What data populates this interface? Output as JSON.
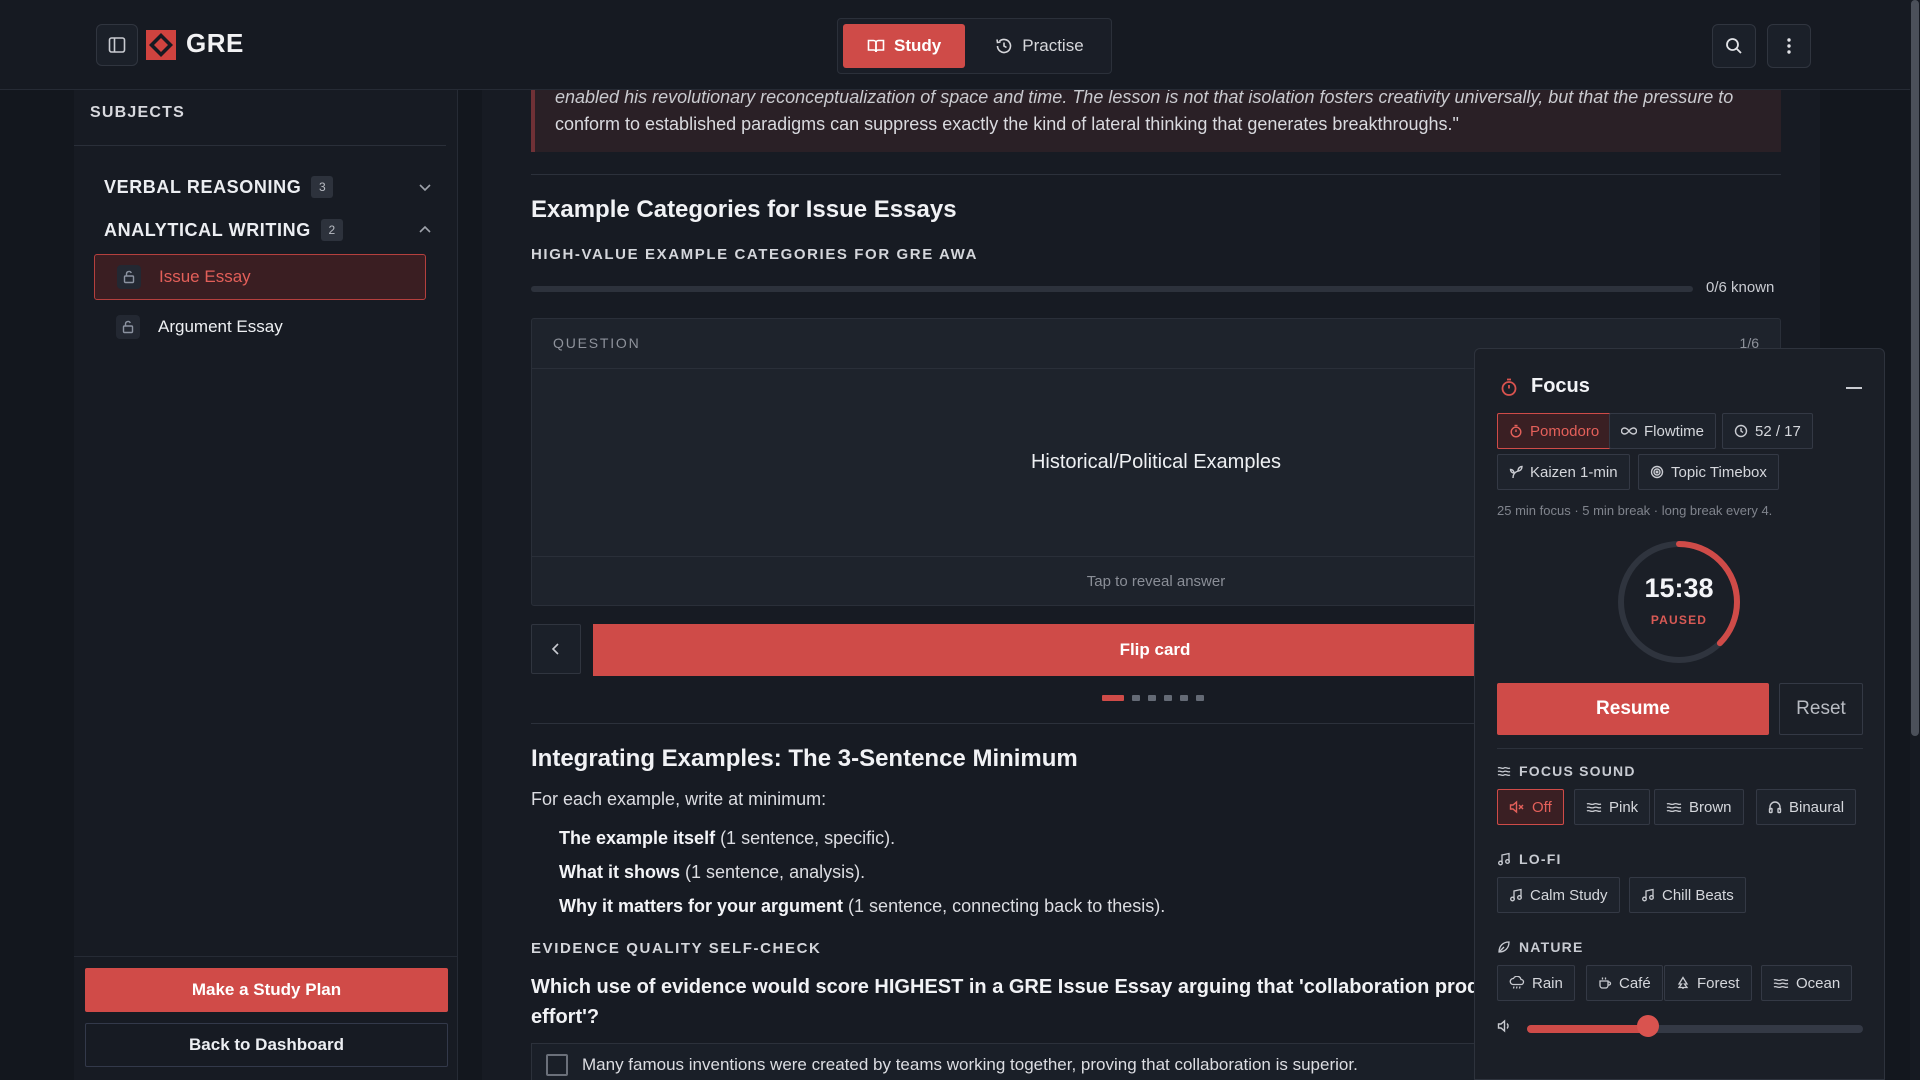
{
  "header": {
    "app_title": "GRE",
    "modes": [
      {
        "label": "Study",
        "icon": "book-open-icon",
        "active": true
      },
      {
        "label": "Practise",
        "icon": "history-icon",
        "active": false
      }
    ]
  },
  "sidebar": {
    "heading": "SUBJECTS",
    "groups": [
      {
        "label": "VERBAL REASONING",
        "count": "3",
        "expanded": false
      },
      {
        "label": "ANALYTICAL WRITING",
        "count": "2",
        "expanded": true
      }
    ],
    "items": [
      {
        "label": "Issue Essay",
        "active": true
      },
      {
        "label": "Argument Essay",
        "active": false
      }
    ],
    "footer": {
      "primary_label": "Make a Study Plan",
      "secondary_label": "Back to Dashboard"
    }
  },
  "main": {
    "quote_line1": "enabled his revolutionary reconceptualization of space and time. The lesson is not that isolation fosters creativity universally, but that the pressure to",
    "quote_line2": "conform to established paradigms can suppress exactly the kind of lateral thinking that generates breakthroughs.\"",
    "section1_title": "Example Categories for Issue Essays",
    "deck_title": "HIGH-VALUE EXAMPLE CATEGORIES FOR GRE AWA",
    "progress_label": "0/6 known",
    "progress_fraction": 0,
    "card": {
      "kind": "QUESTION",
      "position": "1/6",
      "text": "Historical/Political Examples",
      "hint": "Tap to reveal answer"
    },
    "flip_label": "Flip card",
    "dots_total": 6,
    "dots_active_index": 0,
    "section2_title": "Integrating Examples: The 3-Sentence Minimum",
    "intro": "For each example, write at minimum:",
    "bullets": [
      {
        "bold": "The example itself",
        "rest": " (1 sentence, specific)."
      },
      {
        "bold": "What it shows",
        "rest": " (1 sentence, analysis)."
      },
      {
        "bold": "Why it matters for your argument",
        "rest": " (1 sentence, connecting back to thesis)."
      }
    ],
    "check_title": "EVIDENCE QUALITY SELF-CHECK",
    "question": "Which use of evidence would score HIGHEST in a GRE Issue Essay arguing that 'collaboration produces better results than individual effort'?",
    "option1": "Many famous inventions were created by teams working together, proving that collaboration is superior."
  },
  "focus": {
    "title": "Focus",
    "techniques": [
      {
        "label": "Pomodoro",
        "icon": "timer-icon",
        "active": true
      },
      {
        "label": "Flowtime",
        "icon": "infinity-icon",
        "active": false
      },
      {
        "label": "52 / 17",
        "icon": "clock-icon",
        "active": false
      },
      {
        "label": "Kaizen 1-min",
        "icon": "sprout-icon",
        "active": false
      },
      {
        "label": "Topic Timebox",
        "icon": "target-icon",
        "active": false
      }
    ],
    "note": "25 min focus · 5 min break · long break every 4.",
    "time": "15:38",
    "state": "PAUSED",
    "remaining_fraction": 0.375,
    "resume_label": "Resume",
    "reset_label": "Reset",
    "focus_sound_label": "FOCUS SOUND",
    "sounds": [
      {
        "label": "Off",
        "icon": "volume-off-icon",
        "active": true
      },
      {
        "label": "Pink",
        "icon": "waves-icon",
        "active": false
      },
      {
        "label": "Brown",
        "icon": "waves-icon",
        "active": false
      },
      {
        "label": "Binaural",
        "icon": "headphones-icon",
        "active": false
      }
    ],
    "lofi_label": "LO-FI",
    "lofi": [
      {
        "label": "Calm Study",
        "icon": "music-icon"
      },
      {
        "label": "Chill Beats",
        "icon": "music-icon"
      }
    ],
    "nature_label": "NATURE",
    "nature": [
      {
        "label": "Rain",
        "icon": "cloud-rain-icon"
      },
      {
        "label": "Café",
        "icon": "coffee-icon"
      },
      {
        "label": "Forest",
        "icon": "tree-icon"
      },
      {
        "label": "Ocean",
        "icon": "waves-icon"
      }
    ],
    "volume_fraction": 0.36
  },
  "colors": {
    "accent": "#cf4b48",
    "background": "#171b23"
  }
}
